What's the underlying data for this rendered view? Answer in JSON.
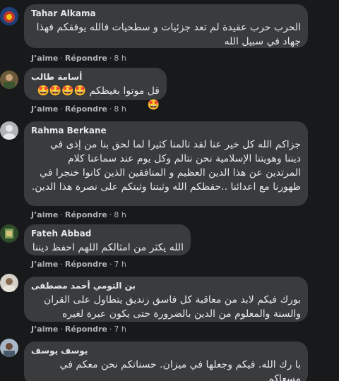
{
  "actions": {
    "like": "J’aime",
    "reply": "Répondre",
    "separator": "·"
  },
  "comments": [
    {
      "author": "Tahar Alkama",
      "text": "الحرب حرب عقيدة لم تعد جزئيات و سطحيات فالله يوفقكم فهذا جهاد في سبيل الله",
      "time": "8 h"
    },
    {
      "author": "أسامة طالب",
      "text": "قل موتوا بغيظكم 🤩🤩🤩🤩🤩",
      "time": "8 h"
    },
    {
      "author": "Rahma Berkane",
      "text": "جزاكم الله كل خير عنا لقد تالمنا كثيرا لما لحق بنا من إذى في ديننا وهويتنا الإسلامية نحن نتالم وكل يوم عند سماعنا كلام المرتدين عن هذا الدين العظيم و المنافقين الذين كانوا خنجرا في ظهورنا مع اعدائنا ..حفظكم الله وثبتنا وثبتكم على نصرة هذا الدين.",
      "time": "8 h"
    },
    {
      "author": "Fateh Abbad",
      "text": "الله يكثر من امثالكم اللهم احفظ ديننا",
      "time": "7 h"
    },
    {
      "author": "بن التومي أحمد مصطفى",
      "text": "بورك فيكم لابد من معاقبة كل فاسق زنديق يتطاول على القران والسنة والمعلوم من الدين بالضرورة حتى يكون عبرة لغيره",
      "time": "7 h"
    },
    {
      "author": "يوسف يوسف",
      "text": "با رك الله. فيكم وجعلها في ميزان. حسناتكم نحن معكم في مسعاكم",
      "time": ""
    }
  ]
}
